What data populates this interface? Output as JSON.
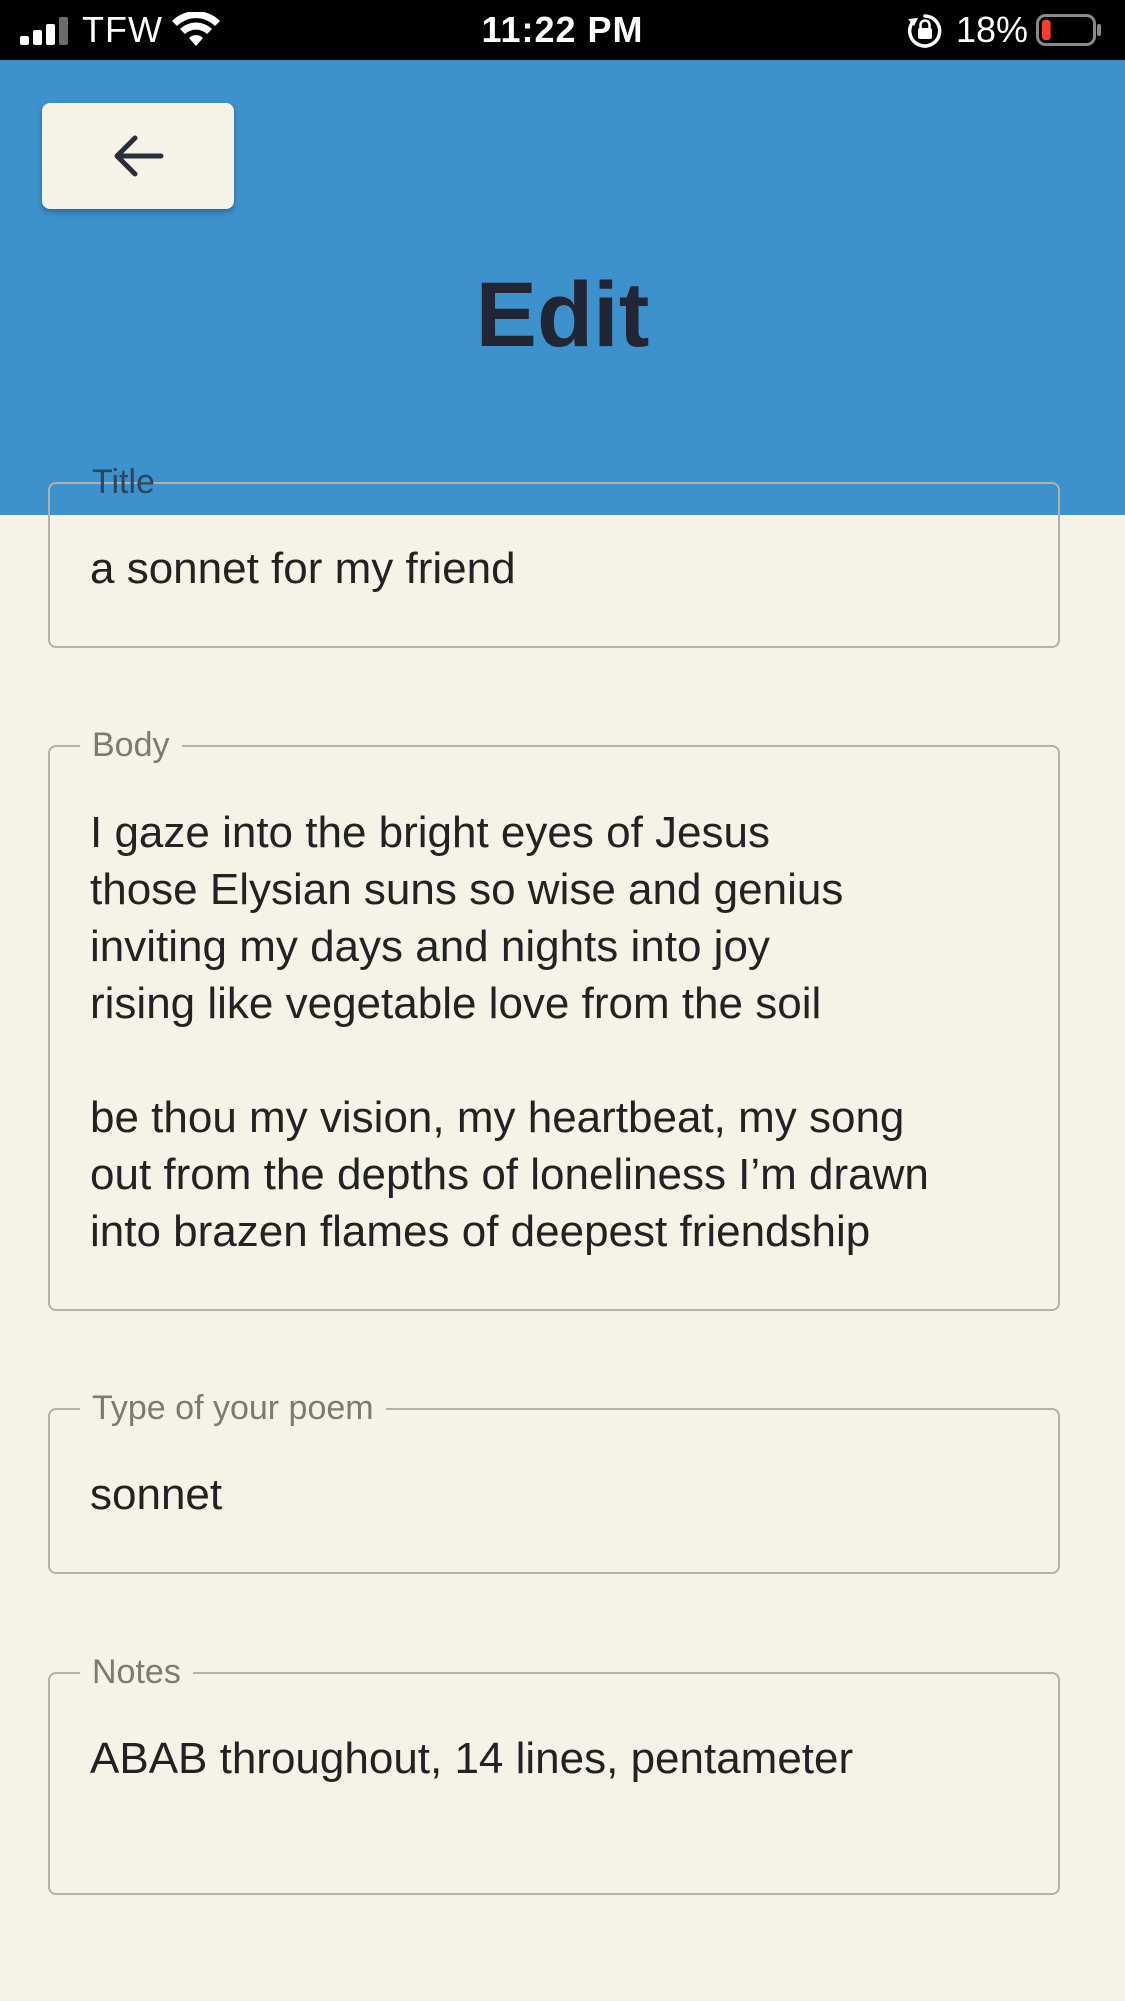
{
  "status_bar": {
    "carrier": "TFW",
    "time": "11:22 PM",
    "battery_percent": "18%",
    "battery_level": 0.18,
    "icons": [
      "signal-icon",
      "wifi-icon",
      "rotation-lock-icon",
      "battery-icon"
    ]
  },
  "header": {
    "title": "Edit",
    "back_icon": "arrow-left-icon",
    "background_color": "#3d91cc"
  },
  "form": {
    "title": {
      "label": "Title",
      "value": "a sonnet for my friend"
    },
    "body": {
      "label": "Body",
      "value": "I gaze into the bright eyes of Jesus\nthose Elysian suns so wise and genius\ninviting my days and nights into joy\nrising like vegetable love from the soil\n\nbe thou my vision, my heartbeat, my song\nout from the depths of loneliness I’m drawn\ninto brazen flames of deepest friendship"
    },
    "type": {
      "label": "Type of your poem",
      "value": "sonnet"
    },
    "notes": {
      "label": "Notes",
      "value": "ABAB throughout, 14 lines, pentameter"
    }
  },
  "colors": {
    "page_background": "#f5f3e7",
    "accent": "#3d91cc",
    "title_text": "#222533",
    "battery_low": "#ff3b30"
  }
}
